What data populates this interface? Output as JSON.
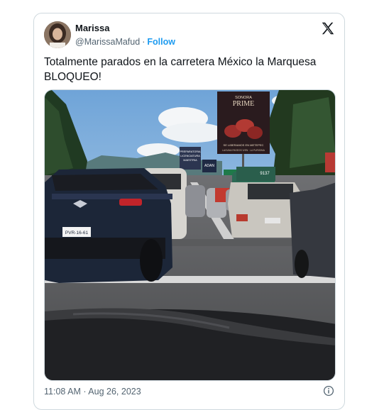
{
  "author": {
    "name": "Marissa",
    "handle": "@MarissaMafud",
    "separator": "·",
    "follow_label": "Follow"
  },
  "tweet": {
    "text": "Totalmente parados en la carretera México la Marquesa BLOQUEO!",
    "timestamp": "11:08 AM · Aug 26, 2023"
  },
  "photo": {
    "billboard_brand": "SONORA",
    "billboard_title": "PRIME",
    "billboard_tagline": "SE LIBERAMOS EN METEPEC",
    "billboard_sub": "LAGUNA PASEOS IVEN · LA PURISIMA",
    "sign_left_1": "PREPARATORIA",
    "sign_left_2": "LICENCIATURA",
    "sign_left_3": "MAESTRIA",
    "sign_adan": "ADAN",
    "bus_number": "9137",
    "plate_front": "PVR-16-61",
    "plate_right": "—"
  },
  "icons": {
    "platform_logo": "x-logo-icon",
    "info": "info-icon"
  },
  "colors": {
    "accent": "#1d9bf0",
    "text": "#0f1419",
    "muted": "#536471",
    "border": "#cfd9de"
  }
}
